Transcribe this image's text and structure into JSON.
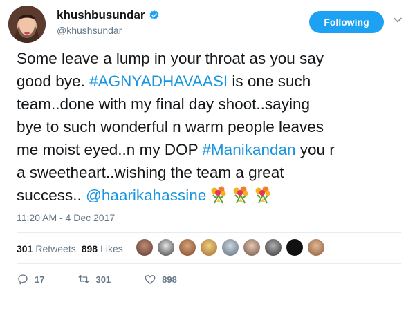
{
  "user": {
    "display_name": "khushbusundar",
    "handle": "@khushsundar",
    "verified_icon": "verified-badge-icon"
  },
  "follow_button": {
    "label": "Following"
  },
  "tweet": {
    "lines": [
      "Some leave a lump in your throat as you say",
      "good bye. ",
      "team..done with my final day shoot..saying",
      "bye to such wonderful n warm people leaves",
      "me moist eyed..n my DOP ",
      "a sweetheart..wishing the team a great",
      "success.. "
    ],
    "hashtag1": "#AGNYADHAVAASI",
    "line2_tail": " is one such",
    "hashtag2": "#Manikandan",
    "line5_tail": " you r",
    "mention": "@haarikahassine",
    "emoji_icons": [
      "bouquet-icon",
      "bouquet-icon",
      "bouquet-icon"
    ]
  },
  "timestamp": "11:20 AM - 4 Dec 2017",
  "stats": {
    "retweets_count": "301",
    "retweets_label": "Retweets",
    "likes_count": "898",
    "likes_label": "Likes"
  },
  "actions": {
    "reply_count": "17",
    "retweet_count": "301",
    "like_count": "898"
  },
  "colors": {
    "accent": "#1da1f2",
    "link": "#1b95e0",
    "muted": "#657786"
  }
}
